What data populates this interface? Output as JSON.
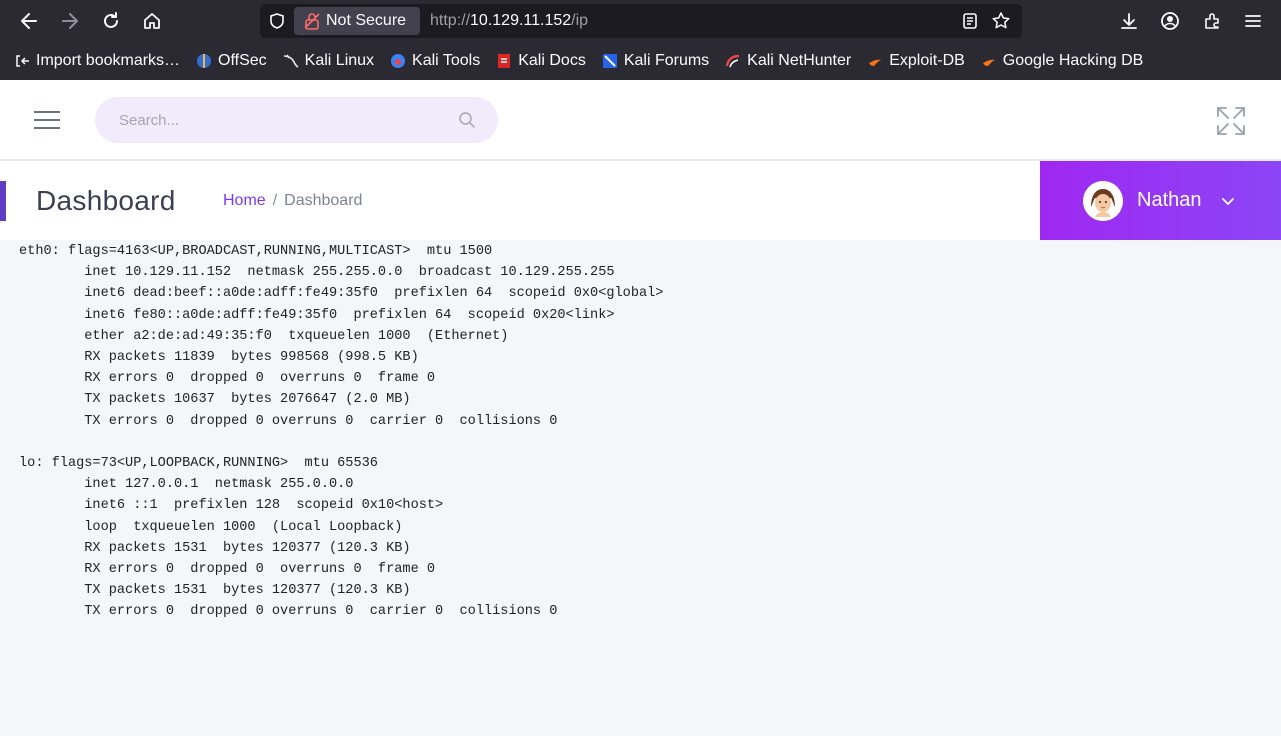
{
  "browser": {
    "security_label": "Not Secure",
    "url_scheme": "http://",
    "url_host": "10.129.11.152",
    "url_path": "/ip",
    "icons": [
      "back-icon",
      "forward-icon",
      "reload-icon",
      "home-icon",
      "shield-icon",
      "lock-slash-icon",
      "reader-icon",
      "star-icon",
      "download-icon",
      "account-icon",
      "extensions-icon",
      "menu-icon"
    ]
  },
  "bookmarks": [
    {
      "label": "Import bookmarks…",
      "icon": "import-icon"
    },
    {
      "label": "OffSec",
      "icon": "offsec-icon"
    },
    {
      "label": "Kali Linux",
      "icon": "kali-dragon-icon"
    },
    {
      "label": "Kali Tools",
      "icon": "kali-tools-icon"
    },
    {
      "label": "Kali Docs",
      "icon": "kali-docs-icon"
    },
    {
      "label": "Kali Forums",
      "icon": "kali-forums-icon"
    },
    {
      "label": "Kali NetHunter",
      "icon": "nethunter-icon"
    },
    {
      "label": "Exploit-DB",
      "icon": "exploit-db-icon"
    },
    {
      "label": "Google Hacking DB",
      "icon": "ghdb-icon"
    }
  ],
  "topbar": {
    "search_placeholder": "Search..."
  },
  "header": {
    "title": "Dashboard",
    "breadcrumb_home": "Home",
    "breadcrumb_sep": "/",
    "breadcrumb_current": "Dashboard"
  },
  "user": {
    "name": "Nathan"
  },
  "colors": {
    "accent": "#8c45f7",
    "breadcrumb_link": "#7c3aed",
    "browser_chrome": "#2b2a33"
  },
  "output_lines": [
    "eth0: flags=4163<UP,BROADCAST,RUNNING,MULTICAST>  mtu 1500",
    "        inet 10.129.11.152  netmask 255.255.0.0  broadcast 10.129.255.255",
    "        inet6 dead:beef::a0de:adff:fe49:35f0  prefixlen 64  scopeid 0x0<global>",
    "        inet6 fe80::a0de:adff:fe49:35f0  prefixlen 64  scopeid 0x20<link>",
    "        ether a2:de:ad:49:35:f0  txqueuelen 1000  (Ethernet)",
    "        RX packets 11839  bytes 998568 (998.5 KB)",
    "        RX errors 0  dropped 0  overruns 0  frame 0",
    "        TX packets 10637  bytes 2076647 (2.0 MB)",
    "        TX errors 0  dropped 0 overruns 0  carrier 0  collisions 0",
    "",
    "lo: flags=73<UP,LOOPBACK,RUNNING>  mtu 65536",
    "        inet 127.0.0.1  netmask 255.0.0.0",
    "        inet6 ::1  prefixlen 128  scopeid 0x10<host>",
    "        loop  txqueuelen 1000  (Local Loopback)",
    "        RX packets 1531  bytes 120377 (120.3 KB)",
    "        RX errors 0  dropped 0  overruns 0  frame 0",
    "        TX packets 1531  bytes 120377 (120.3 KB)",
    "        TX errors 0  dropped 0 overruns 0  carrier 0  collisions 0"
  ]
}
